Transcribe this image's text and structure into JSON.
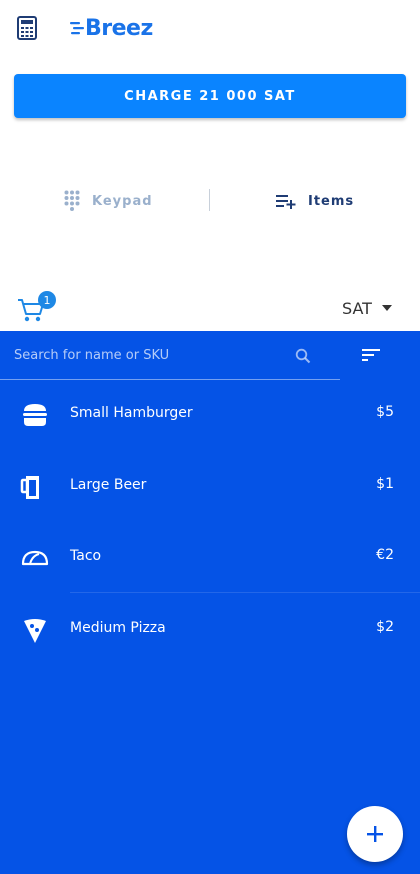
{
  "header": {
    "logo_text": "Breez",
    "logo_color": "#1a73e8"
  },
  "charge": {
    "label": "CHARGE 21 000 SAT",
    "color": "#0a84ff"
  },
  "modes": {
    "keypad_label": "Keypad",
    "items_label": "Items",
    "selected": "Items"
  },
  "cart": {
    "count": "1"
  },
  "currency": {
    "selected": "SAT"
  },
  "search": {
    "placeholder": "Search for name or SKU"
  },
  "items": [
    {
      "name": "Small Hamburger",
      "price": "$5",
      "icon": "hamburger-icon"
    },
    {
      "name": "Large Beer",
      "price": "$1",
      "icon": "beer-icon"
    },
    {
      "name": "Taco",
      "price": "€2",
      "icon": "taco-icon"
    },
    {
      "name": "Medium Pizza",
      "price": "$2",
      "icon": "pizza-icon"
    }
  ],
  "panel_color": "#0553e6"
}
